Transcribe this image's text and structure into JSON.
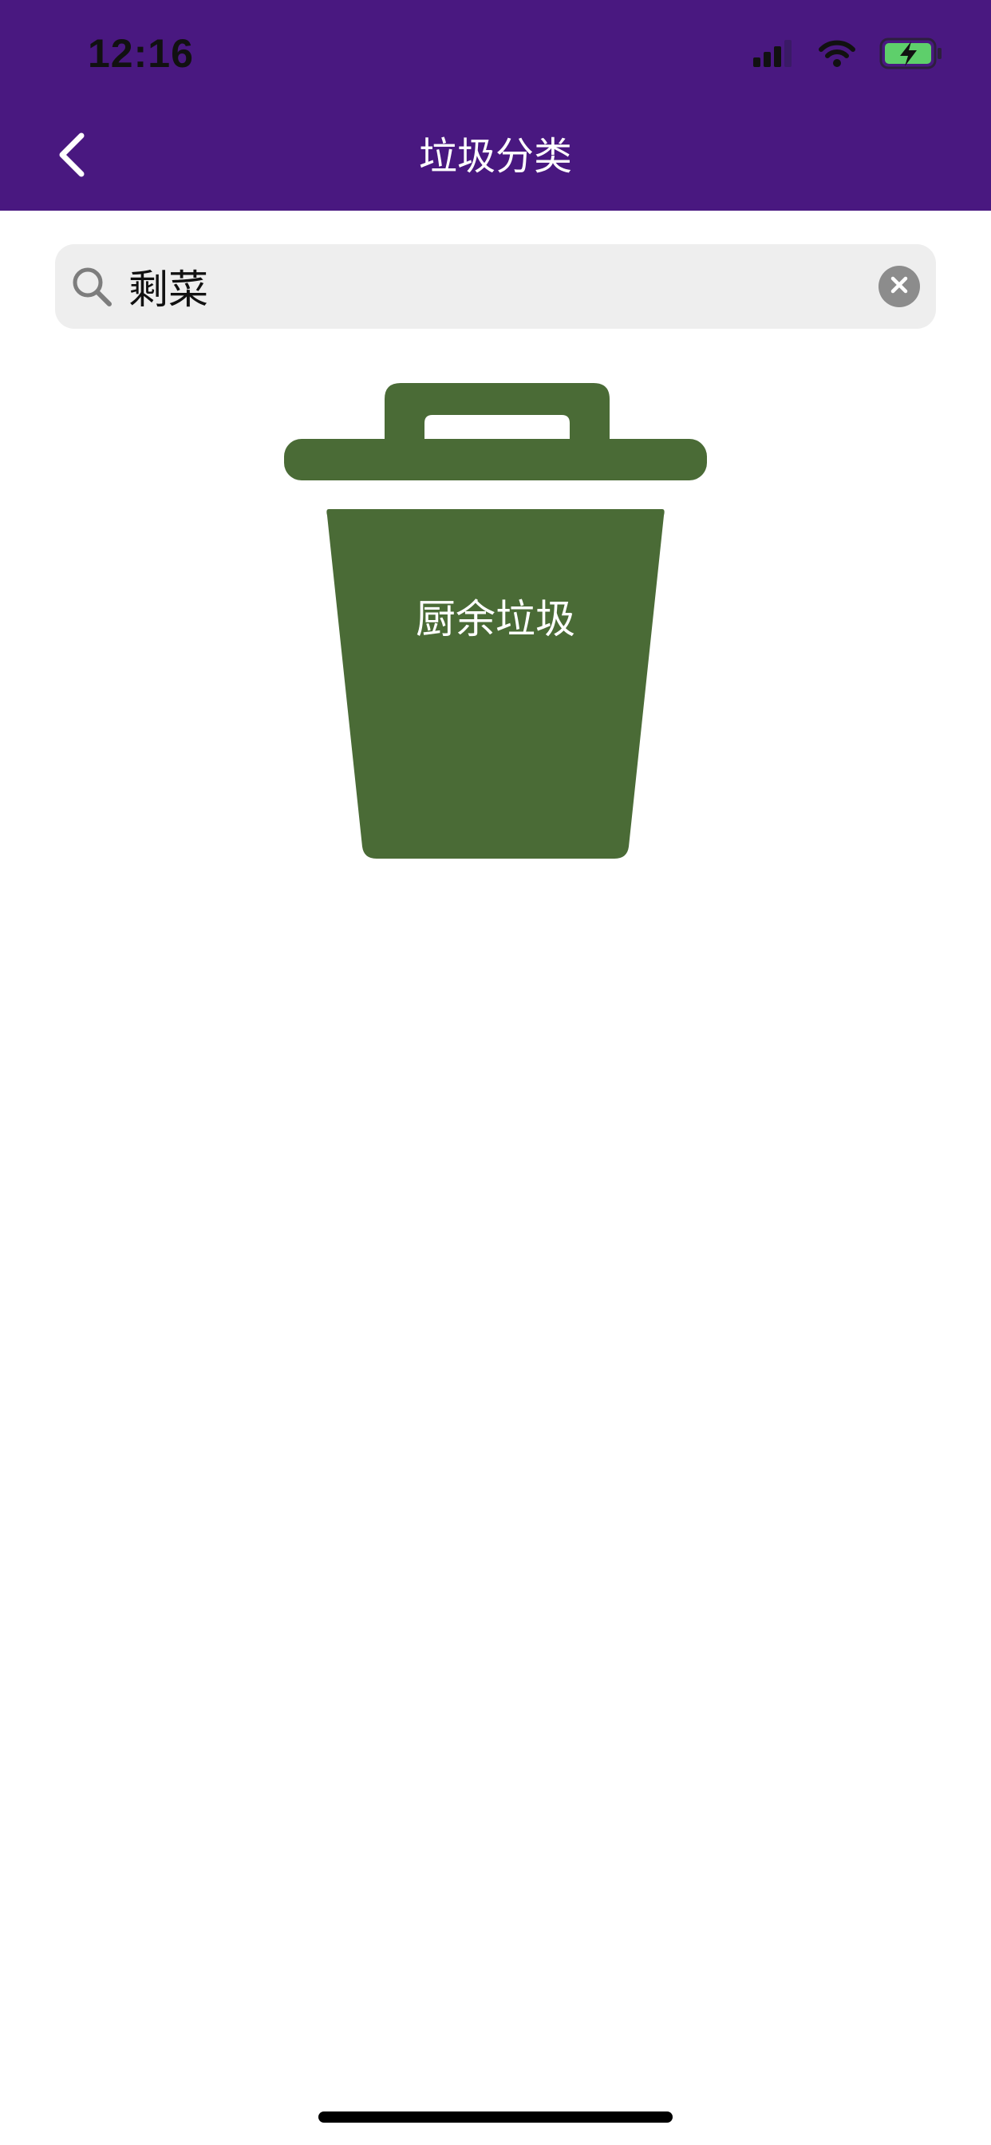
{
  "status_bar": {
    "time": "12:16"
  },
  "header": {
    "title": "垃圾分类",
    "background_color": "#491880",
    "back_icon": "chevron-left-icon"
  },
  "search": {
    "value": "剩菜",
    "icon": "search-icon",
    "clear_icon": "clear-icon"
  },
  "result": {
    "category": "厨余垃圾",
    "bin_color": "#4a6b36",
    "icon": "trash-bin-icon"
  }
}
